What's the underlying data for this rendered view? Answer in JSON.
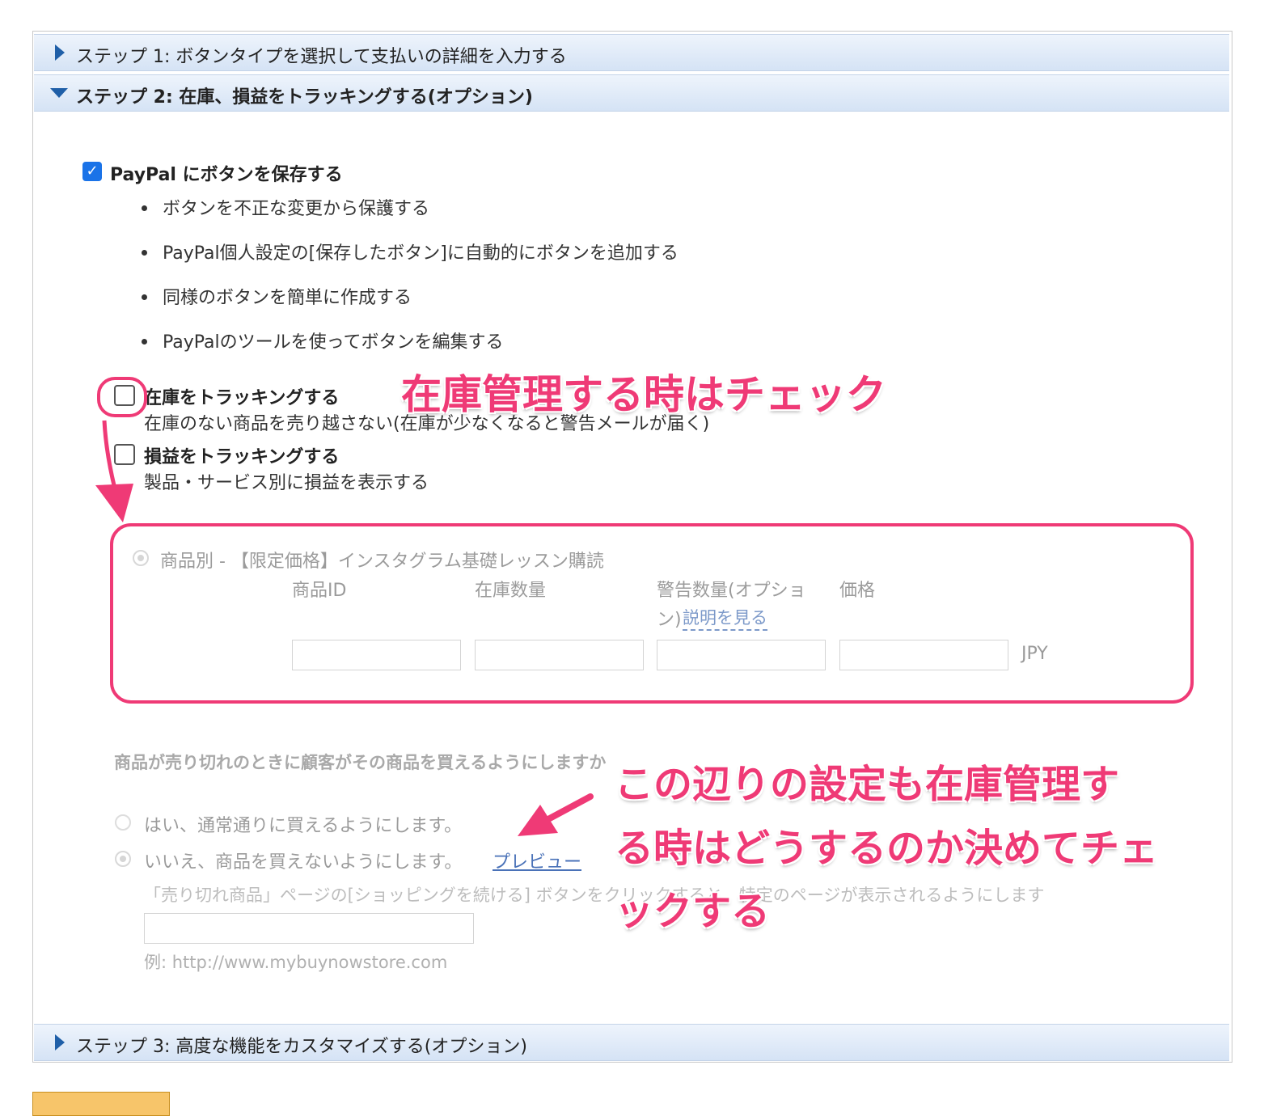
{
  "steps": {
    "step1": "ステップ 1: ボタンタイプを選択して支払いの詳細を入力する",
    "step2": "ステップ 2: 在庫、損益をトラッキングする(オプション)",
    "step3": "ステップ 3: 高度な機能をカスタマイズする(オプション)"
  },
  "save_to_paypal": {
    "label": "PayPal にボタンを保存する",
    "checked": true,
    "bullets": [
      "ボタンを不正な変更から保護する",
      "PayPal個人設定の[保存したボタン]に自動的にボタンを追加する",
      "同様のボタンを簡単に作成する",
      "PayPalのツールを使ってボタンを編集する"
    ]
  },
  "track_inventory": {
    "label": "在庫をトラッキングする",
    "description": "在庫のない商品を売り越さない(在庫が少なくなると警告メールが届く)"
  },
  "track_profit": {
    "label": "損益をトラッキングする",
    "description": "製品・サービス別に損益を表示する"
  },
  "item_tracking": {
    "radio_label": "商品別 - 【限定価格】インスタグラム基礎レッスン購読",
    "columns": {
      "item_id": "商品ID",
      "quantity": "在庫数量",
      "alert_line1": "警告数量(オプショ",
      "alert_line2": "ン)",
      "alert_link": "説明を見る",
      "price": "価格"
    },
    "currency": "JPY"
  },
  "sold_out": {
    "question": "商品が売り切れのときに顧客がその商品を買えるようにしますか",
    "yes": "はい、通常通りに買えるようにします。",
    "no": "いいえ、商品を買えないようにします。",
    "preview_link": "プレビュー",
    "redirect_note": "「売り切れ商品」ページの[ショッピングを続ける] ボタンをクリックすると、特定のページが表示されるようにします",
    "url_example": "例: http://www.mybuynowstore.com"
  },
  "annotations": {
    "a1": "在庫管理する時はチェック",
    "a2_line1": "この辺りの設定も在庫管理す",
    "a2_line2": "る時はどうするのか決めてチェ",
    "a2_line3": "ックする"
  },
  "colors": {
    "accent_pink": "#ef3a76",
    "header_blue": "#1f5fa8",
    "checkbox_blue": "#1a73e8"
  }
}
